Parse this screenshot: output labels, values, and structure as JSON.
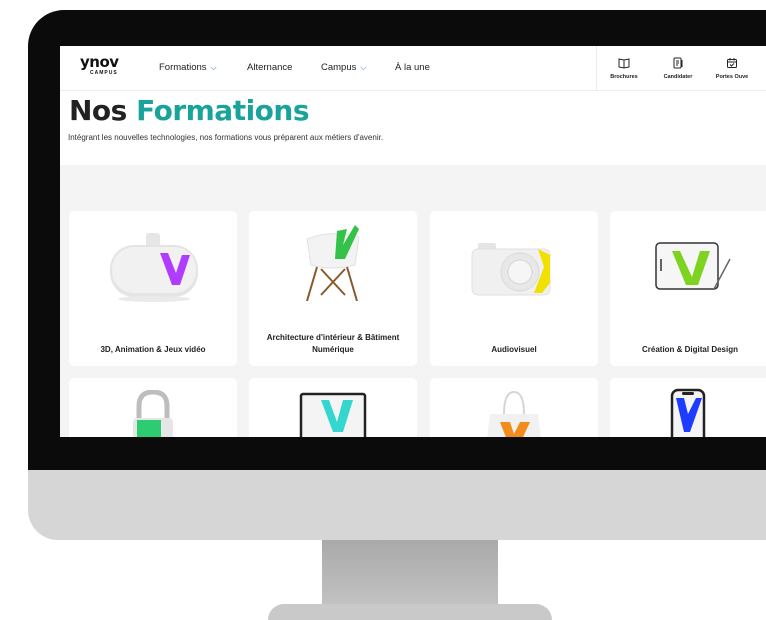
{
  "nav": {
    "logo_main": "ynov",
    "logo_sub": "CAMPUS",
    "items": [
      {
        "label": "Formations",
        "has_dropdown": true
      },
      {
        "label": "Alternance",
        "has_dropdown": false
      },
      {
        "label": "Campus",
        "has_dropdown": true
      },
      {
        "label": "À la une",
        "has_dropdown": false
      }
    ],
    "tools": [
      {
        "label": "Brochures",
        "icon": "book-icon"
      },
      {
        "label": "Candidater",
        "icon": "document-icon"
      },
      {
        "label": "Portes Ouve",
        "icon": "calendar-icon"
      }
    ]
  },
  "hero": {
    "title_part1": "Nos",
    "title_part2": "Formations",
    "subtitle": "Intégrant les nouvelles technologies, nos formations vous préparent aux métiers d'avenir."
  },
  "formations": [
    {
      "label": "3D, Animation & Jeux vidéo",
      "image": "vr-headset",
      "accent": "#b03cff"
    },
    {
      "label": "Architecture d'intérieur & Bâtiment Numérique",
      "image": "chair",
      "accent": "#35c24a"
    },
    {
      "label": "Audiovisuel",
      "image": "camera",
      "accent": "#f2e000"
    },
    {
      "label": "Création & Digital Design",
      "image": "tablet",
      "accent": "#7ed321"
    },
    {
      "label": "",
      "image": "padlock",
      "accent": "#2ecc71"
    },
    {
      "label": "",
      "image": "laptop",
      "accent": "#34d6d0"
    },
    {
      "label": "",
      "image": "tote-bag",
      "accent": "#f28c1a"
    },
    {
      "label": "",
      "image": "phone",
      "accent": "#1e3cff"
    }
  ],
  "colors": {
    "accent": "#1aa39a",
    "chevron": "#1f6fd0",
    "page_bg": "#f4f4f4"
  }
}
